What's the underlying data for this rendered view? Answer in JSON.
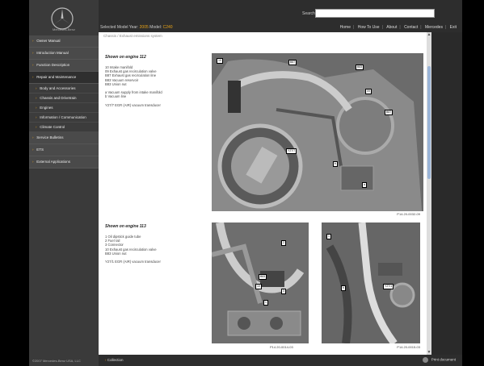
{
  "brand": {
    "name": "Mercedes-Benz"
  },
  "sidebar": {
    "items": [
      {
        "label": "Owner Manual",
        "type": "top"
      },
      {
        "label": "Introduction Manual",
        "type": "top"
      },
      {
        "label": "Function Description",
        "type": "top"
      },
      {
        "label": "Repair and Maintenance",
        "type": "top"
      },
      {
        "label": "Body and Accessories",
        "type": "sub"
      },
      {
        "label": "Chassis and Drivetrain",
        "type": "sub"
      },
      {
        "label": "Engines",
        "type": "sub"
      },
      {
        "label": "Information / Communication",
        "type": "sub"
      },
      {
        "label": "Climate Control",
        "type": "sub"
      },
      {
        "label": "Service Bulletins",
        "type": "top"
      },
      {
        "label": "ETS",
        "type": "top"
      },
      {
        "label": "External Applications",
        "type": "top"
      }
    ],
    "footer": "©2007 Mercedes-Benz USA, LLC"
  },
  "header": {
    "search_label": "Search",
    "search_value": "",
    "selected_model_label": "Selected Model Year:",
    "selected_model_year": "2005",
    "model_label": "Model:",
    "model_value": "C240",
    "nav": [
      "Home",
      "How To Use",
      "About",
      "Contact",
      "Mercedes",
      "Exit"
    ]
  },
  "content": {
    "breadcrumb": "Chassis / Exhaust emissions system",
    "section1": {
      "title": "Shown on engine 112",
      "lines": "10 Intake manifold\n09 Exhaust gas recirculation valve\nB87 Exhaust gas recirculation line\nB83 Vacuum reservoir\nB83 Union nut\n\na Vacuum supply from intake manifold\nb Vacuum line\n\nY27/7 EGR (AIR) vacuum transducer",
      "figure_caption": "P14.20-0032-09",
      "callouts": [
        "10",
        "B87",
        "B83",
        "09",
        "B87",
        "Y27/7",
        "b",
        "a"
      ]
    },
    "section2": {
      "title": "Shown on engine 113",
      "lines": "1 Oil dipstick guide tube\n2 Fuel rail\n3 Connector\n10 Exhaust gas recirculation valve\nB83 Union nut\n\nY27/1 EGR (AIR) vacuum transducer",
      "figure1_caption": "P14.20-0014-03",
      "figure2_caption": "P14.20-0015-03",
      "callouts1": [
        "2",
        "B83",
        "10",
        "3",
        "1"
      ],
      "callouts2": [
        "1",
        "Y27/1",
        "b"
      ]
    }
  },
  "bottombar": {
    "collection": "Collection",
    "print": "Print document"
  }
}
